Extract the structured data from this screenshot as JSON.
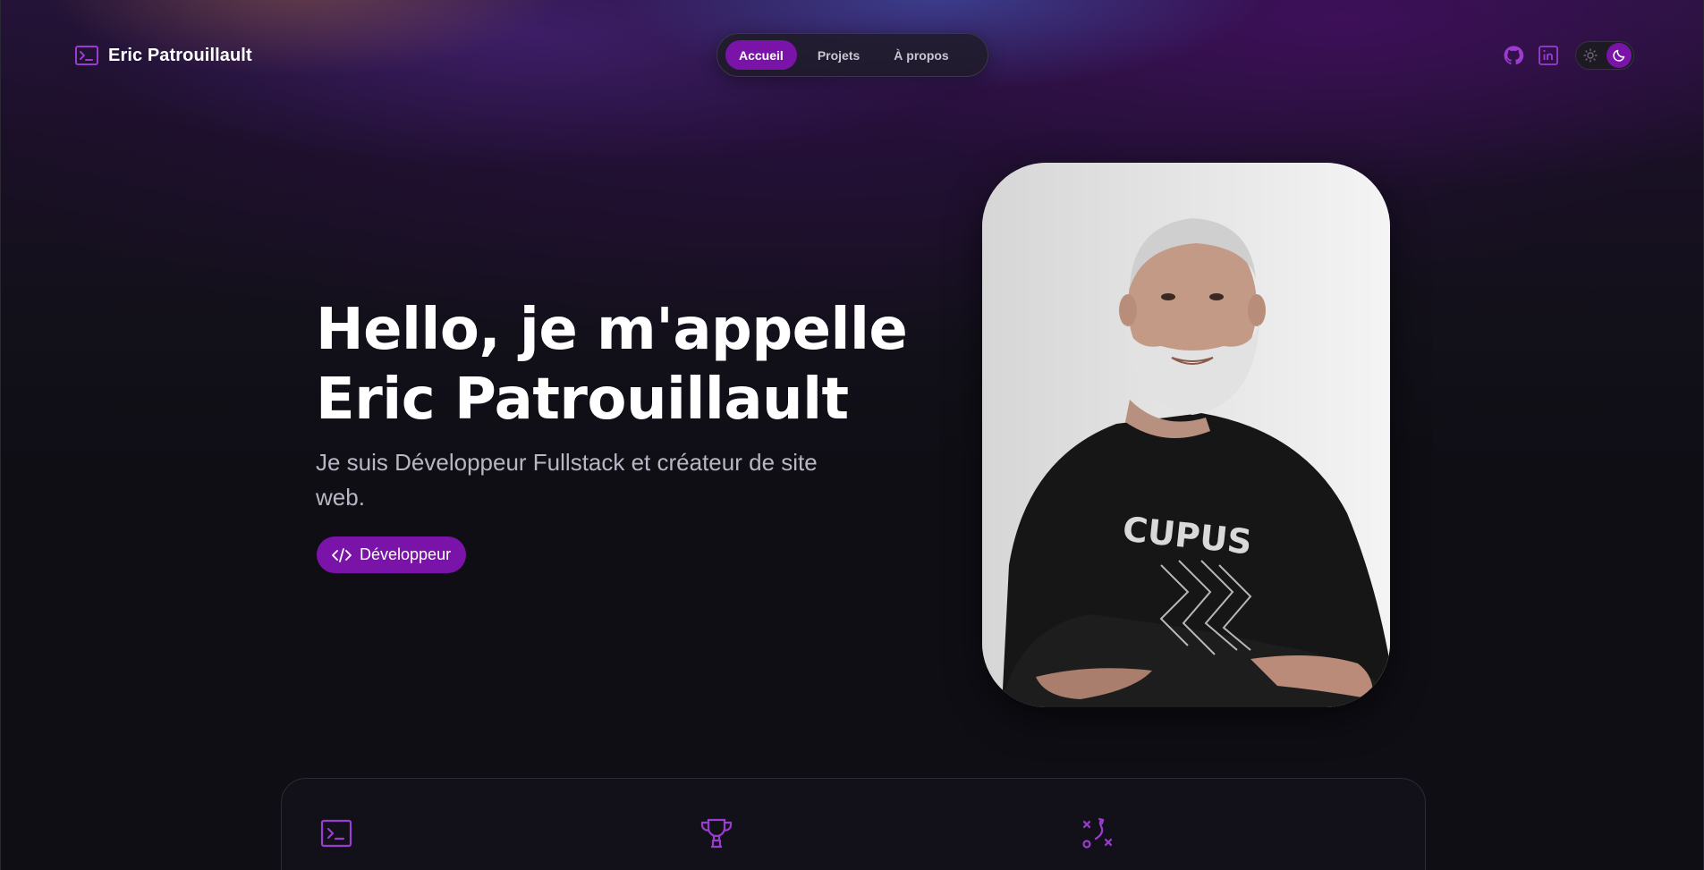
{
  "brand": {
    "name": "Eric Patrouillault",
    "icon": "terminal-icon"
  },
  "nav": {
    "items": [
      {
        "label": "Accueil",
        "active": true
      },
      {
        "label": "Projets",
        "active": false
      },
      {
        "label": "À propos",
        "active": false
      }
    ]
  },
  "header_actions": {
    "github_icon": "github-icon",
    "linkedin_icon": "linkedin-icon",
    "theme_toggle": {
      "options": [
        "sun-icon",
        "moon-icon"
      ],
      "selected": "moon-icon"
    }
  },
  "hero": {
    "title_line1": "Hello, je m'appelle",
    "title_line2": "Eric Patrouillault",
    "subtitle": "Je suis Développeur Fullstack et créateur de site web.",
    "badge_label": "Développeur",
    "badge_icon": "code-icon",
    "portrait_icon": "portrait-photo"
  },
  "features": {
    "icons": [
      "terminal-icon",
      "trophy-icon",
      "strategy-icon"
    ]
  },
  "colors": {
    "accent": "#7a14a8",
    "accent_light": "#9a3ccf",
    "background": "#0f0e15",
    "text": "#ffffff",
    "muted_text": "#b9b6c4"
  }
}
